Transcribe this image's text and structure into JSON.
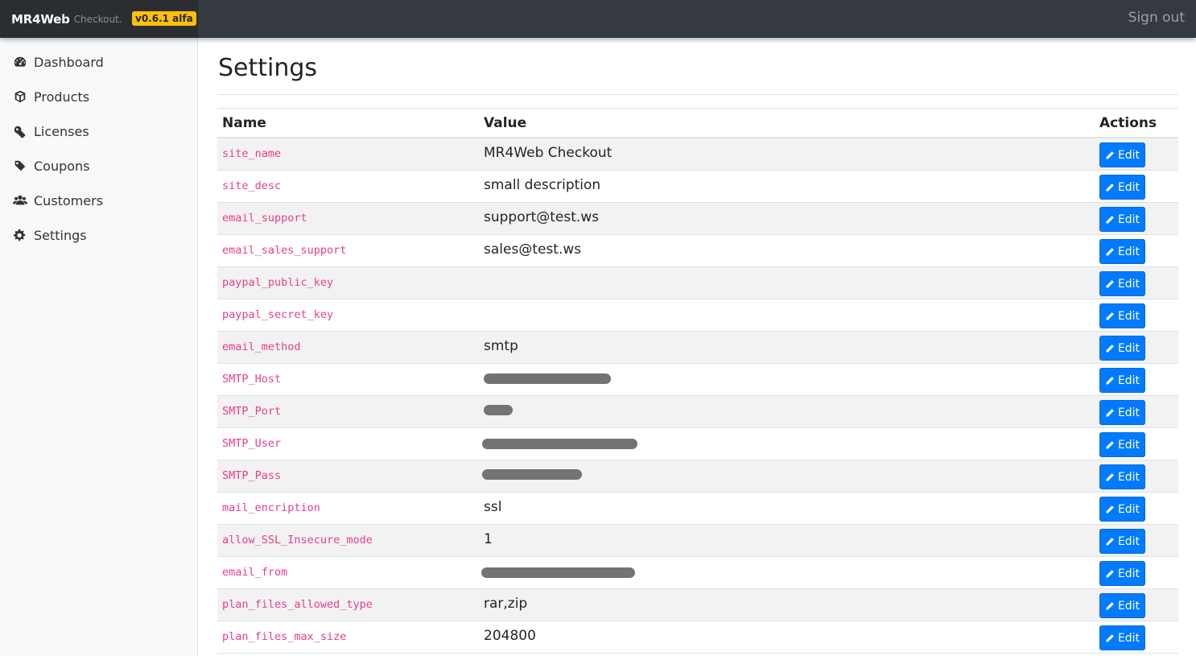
{
  "header": {
    "brand_name": "MR4Web",
    "brand_sub": "Checkout.",
    "version": "v0.6.1 alfa",
    "signout_label": "Sign out"
  },
  "sidebar": {
    "items": [
      {
        "label": "Dashboard",
        "icon": "dashboard-icon"
      },
      {
        "label": "Products",
        "icon": "box-icon"
      },
      {
        "label": "Licenses",
        "icon": "key-icon"
      },
      {
        "label": "Coupons",
        "icon": "tag-icon"
      },
      {
        "label": "Customers",
        "icon": "users-icon"
      },
      {
        "label": "Settings",
        "icon": "gears-icon"
      }
    ]
  },
  "main": {
    "title": "Settings",
    "columns": {
      "name": "Name",
      "value": "Value",
      "actions": "Actions"
    },
    "edit_label": "Edit",
    "rows": [
      {
        "name": "site_name",
        "value": "MR4Web Checkout"
      },
      {
        "name": "site_desc",
        "value": "small description"
      },
      {
        "name": "email_support",
        "value": "support@test.ws"
      },
      {
        "name": "email_sales_support",
        "value": "sales@test.ws"
      },
      {
        "name": "paypal_public_key",
        "value": ""
      },
      {
        "name": "paypal_secret_key",
        "value": ""
      },
      {
        "name": "email_method",
        "value": "smtp"
      },
      {
        "name": "SMTP_Host",
        "value": "",
        "redacted": true
      },
      {
        "name": "SMTP_Port",
        "value": "",
        "redacted": true
      },
      {
        "name": "SMTP_User",
        "value": "",
        "redacted": true
      },
      {
        "name": "SMTP_Pass",
        "value": "",
        "redacted": true
      },
      {
        "name": "mail_encription",
        "value": "ssl"
      },
      {
        "name": "allow_SSL_Insecure_mode",
        "value": "1"
      },
      {
        "name": "email_from",
        "value": "",
        "redacted": true
      },
      {
        "name": "plan_files_allowed_type",
        "value": "rar,zip"
      },
      {
        "name": "plan_files_max_size",
        "value": "204800"
      }
    ]
  },
  "colors": {
    "topbar": "#343a40",
    "badge": "#ffc107",
    "primary": "#007bff",
    "code": "#e83e8c"
  }
}
